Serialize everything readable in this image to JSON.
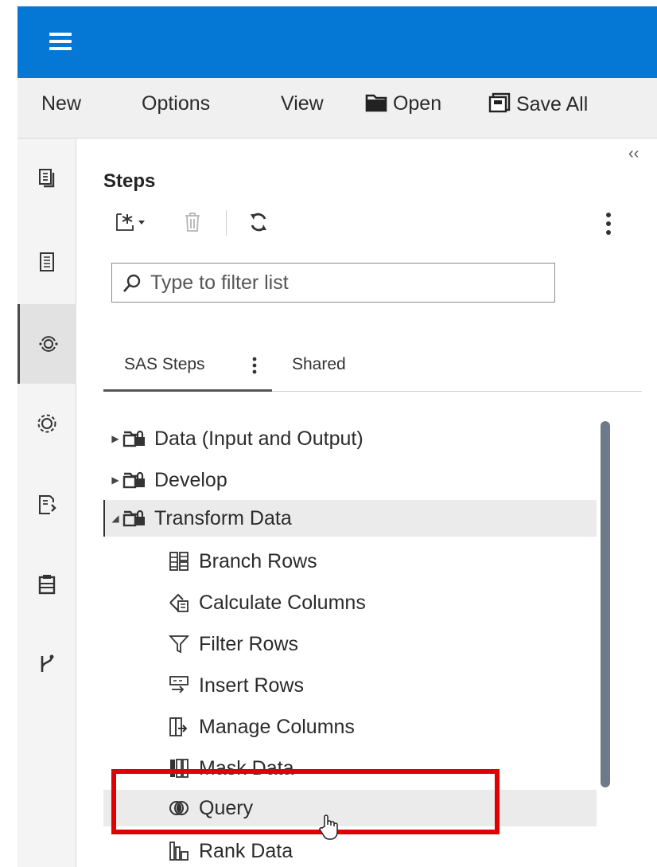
{
  "header": {
    "menu_icon": "hamburger-icon",
    "bg_color": "#0478d4"
  },
  "menubar": {
    "new_label": "New",
    "options_label": "Options",
    "view_label": "View",
    "open_label": "Open",
    "save_all_label": "Save All"
  },
  "rail": {
    "items": [
      "document-icon",
      "report-icon",
      "steps-icon",
      "settings-icon",
      "code-icon",
      "clipboard-icon",
      "git-icon"
    ],
    "active_index": 2
  },
  "panel": {
    "collapse_glyph": "‹‹",
    "title": "Steps",
    "filter_placeholder": "Type to filter list",
    "tabs": {
      "sas_steps": "SAS Steps",
      "shared": "Shared"
    }
  },
  "tree": {
    "folders": [
      {
        "label": "Data (Input and Output)",
        "expanded": false
      },
      {
        "label": "Develop",
        "expanded": false
      },
      {
        "label": "Transform Data",
        "expanded": true
      }
    ],
    "children": [
      {
        "label": "Branch Rows",
        "icon": "branch-rows-icon"
      },
      {
        "label": "Calculate Columns",
        "icon": "calculate-columns-icon"
      },
      {
        "label": "Filter Rows",
        "icon": "filter-icon"
      },
      {
        "label": "Insert Rows",
        "icon": "insert-rows-icon"
      },
      {
        "label": "Manage Columns",
        "icon": "manage-columns-icon"
      },
      {
        "label": "Mask Data",
        "icon": "mask-data-icon"
      },
      {
        "label": "Query",
        "icon": "query-icon"
      },
      {
        "label": "Rank Data",
        "icon": "rank-data-icon"
      }
    ]
  },
  "colors": {
    "highlight_box": "#e00000",
    "scrollbar": "#6d7a8a"
  }
}
